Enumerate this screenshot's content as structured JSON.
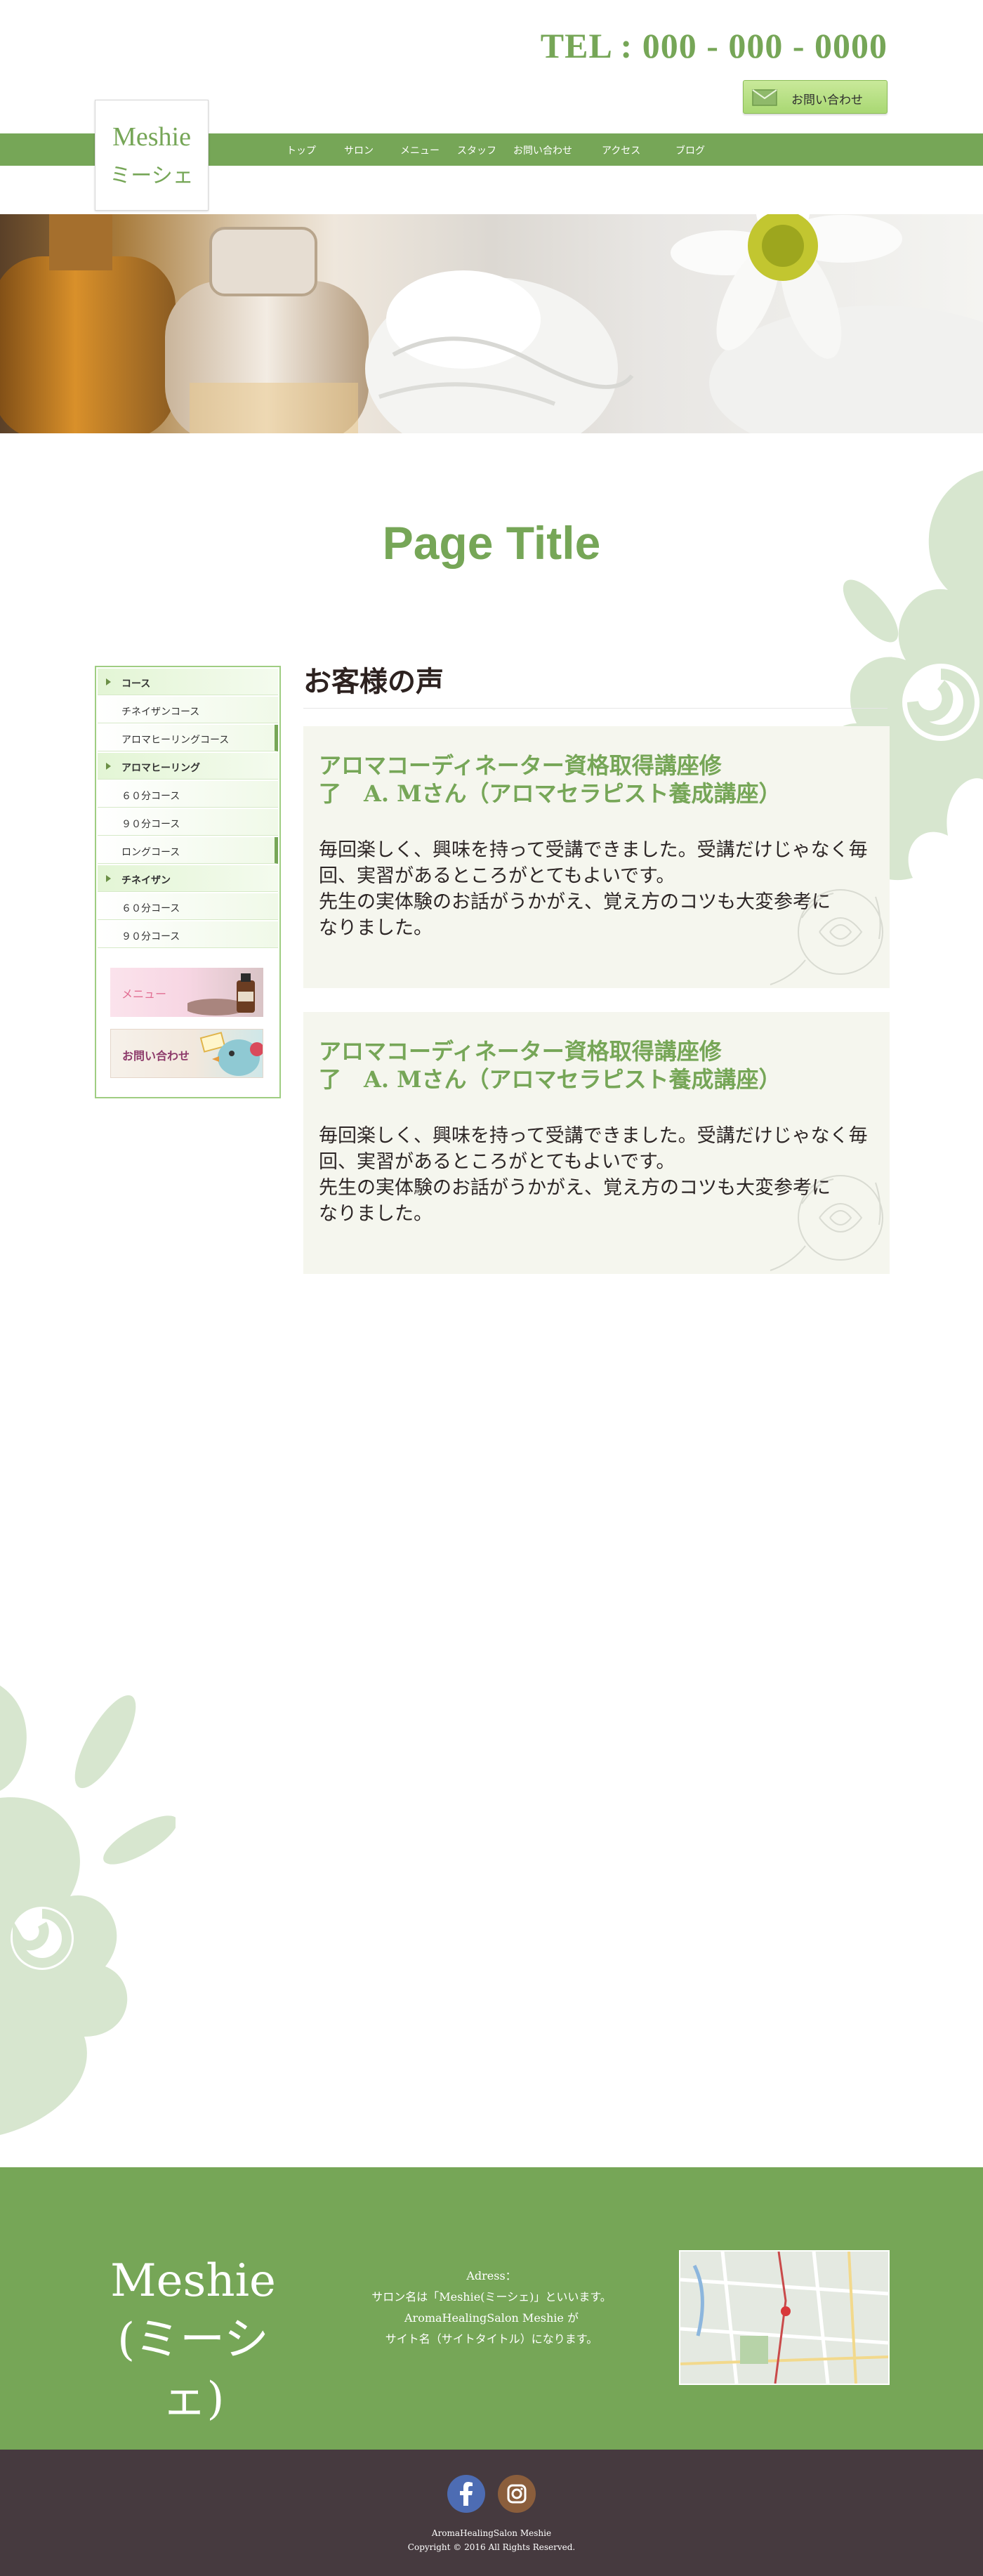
{
  "header": {
    "tel": "TEL : 000 - 000 - 0000",
    "contact_label": "お問い合わせ",
    "logo_line1": "Meshie",
    "logo_line2": "ミーシェ"
  },
  "nav": {
    "items": [
      "トップ",
      "サロン",
      "メニュー",
      "スタッフ",
      "お問い合わせ",
      "アクセス",
      "ブログ"
    ]
  },
  "page": {
    "title": "Page Title"
  },
  "sidebar": {
    "items": [
      {
        "label": "コース",
        "type": "category"
      },
      {
        "label": "チネイザンコース",
        "type": "sub"
      },
      {
        "label": "アロマヒーリングコース",
        "type": "sub"
      },
      {
        "label": "アロマヒーリング",
        "type": "category"
      },
      {
        "label": "６０分コース",
        "type": "sub"
      },
      {
        "label": "９０分コース",
        "type": "sub"
      },
      {
        "label": "ロングコース",
        "type": "sub"
      },
      {
        "label": "チネイザン",
        "type": "category"
      },
      {
        "label": "６０分コース",
        "type": "sub"
      },
      {
        "label": "９０分コース",
        "type": "sub"
      }
    ],
    "banner_menu": "メニュー",
    "banner_contact": "お問い合わせ"
  },
  "main": {
    "heading": "お客様の声",
    "testimonials": [
      {
        "title_line1": "アロマコーディネーター資格取得講座修",
        "title_line2": "了　A. Mさん（アロマセラピスト養成講座）",
        "body": [
          "毎回楽しく、興味を持って受講できました。受講だけじゃなく毎",
          "回、実習があるところがとてもよいです。",
          "先生の実体験のお話がうかがえ、覚え方のコツも大変参考に",
          "なりました。"
        ]
      },
      {
        "title_line1": "アロマコーディネーター資格取得講座修",
        "title_line2": "了　A. Mさん（アロマセラピスト養成講座）",
        "body": [
          "毎回楽しく、興味を持って受講できました。受講だけじゃなく毎",
          "回、実習があるところがとてもよいです。",
          "先生の実体験のお話がうかがえ、覚え方のコツも大変参考に",
          "なりました。"
        ]
      }
    ]
  },
  "footer": {
    "logo_line1": "Meshie",
    "logo_line2": "(ミーシェ)",
    "info": [
      "Adress：",
      "サロン名は「Meshie(ミーシェ)」といいます。",
      "AromaHealingSalon Meshie が",
      "サイト名（サイトタイトル）になります。"
    ],
    "copyright_line1": "AromaHealingSalon Meshie",
    "copyright_line2": "Copyright © 2016 All Rights Reserved."
  },
  "icons": {
    "contact": "mail-icon",
    "facebook": "facebook-icon",
    "instagram": "instagram-icon"
  },
  "colors": {
    "accent": "#76a657",
    "footer_dark": "#463a3f",
    "card_bg": "#f5f6ee"
  }
}
